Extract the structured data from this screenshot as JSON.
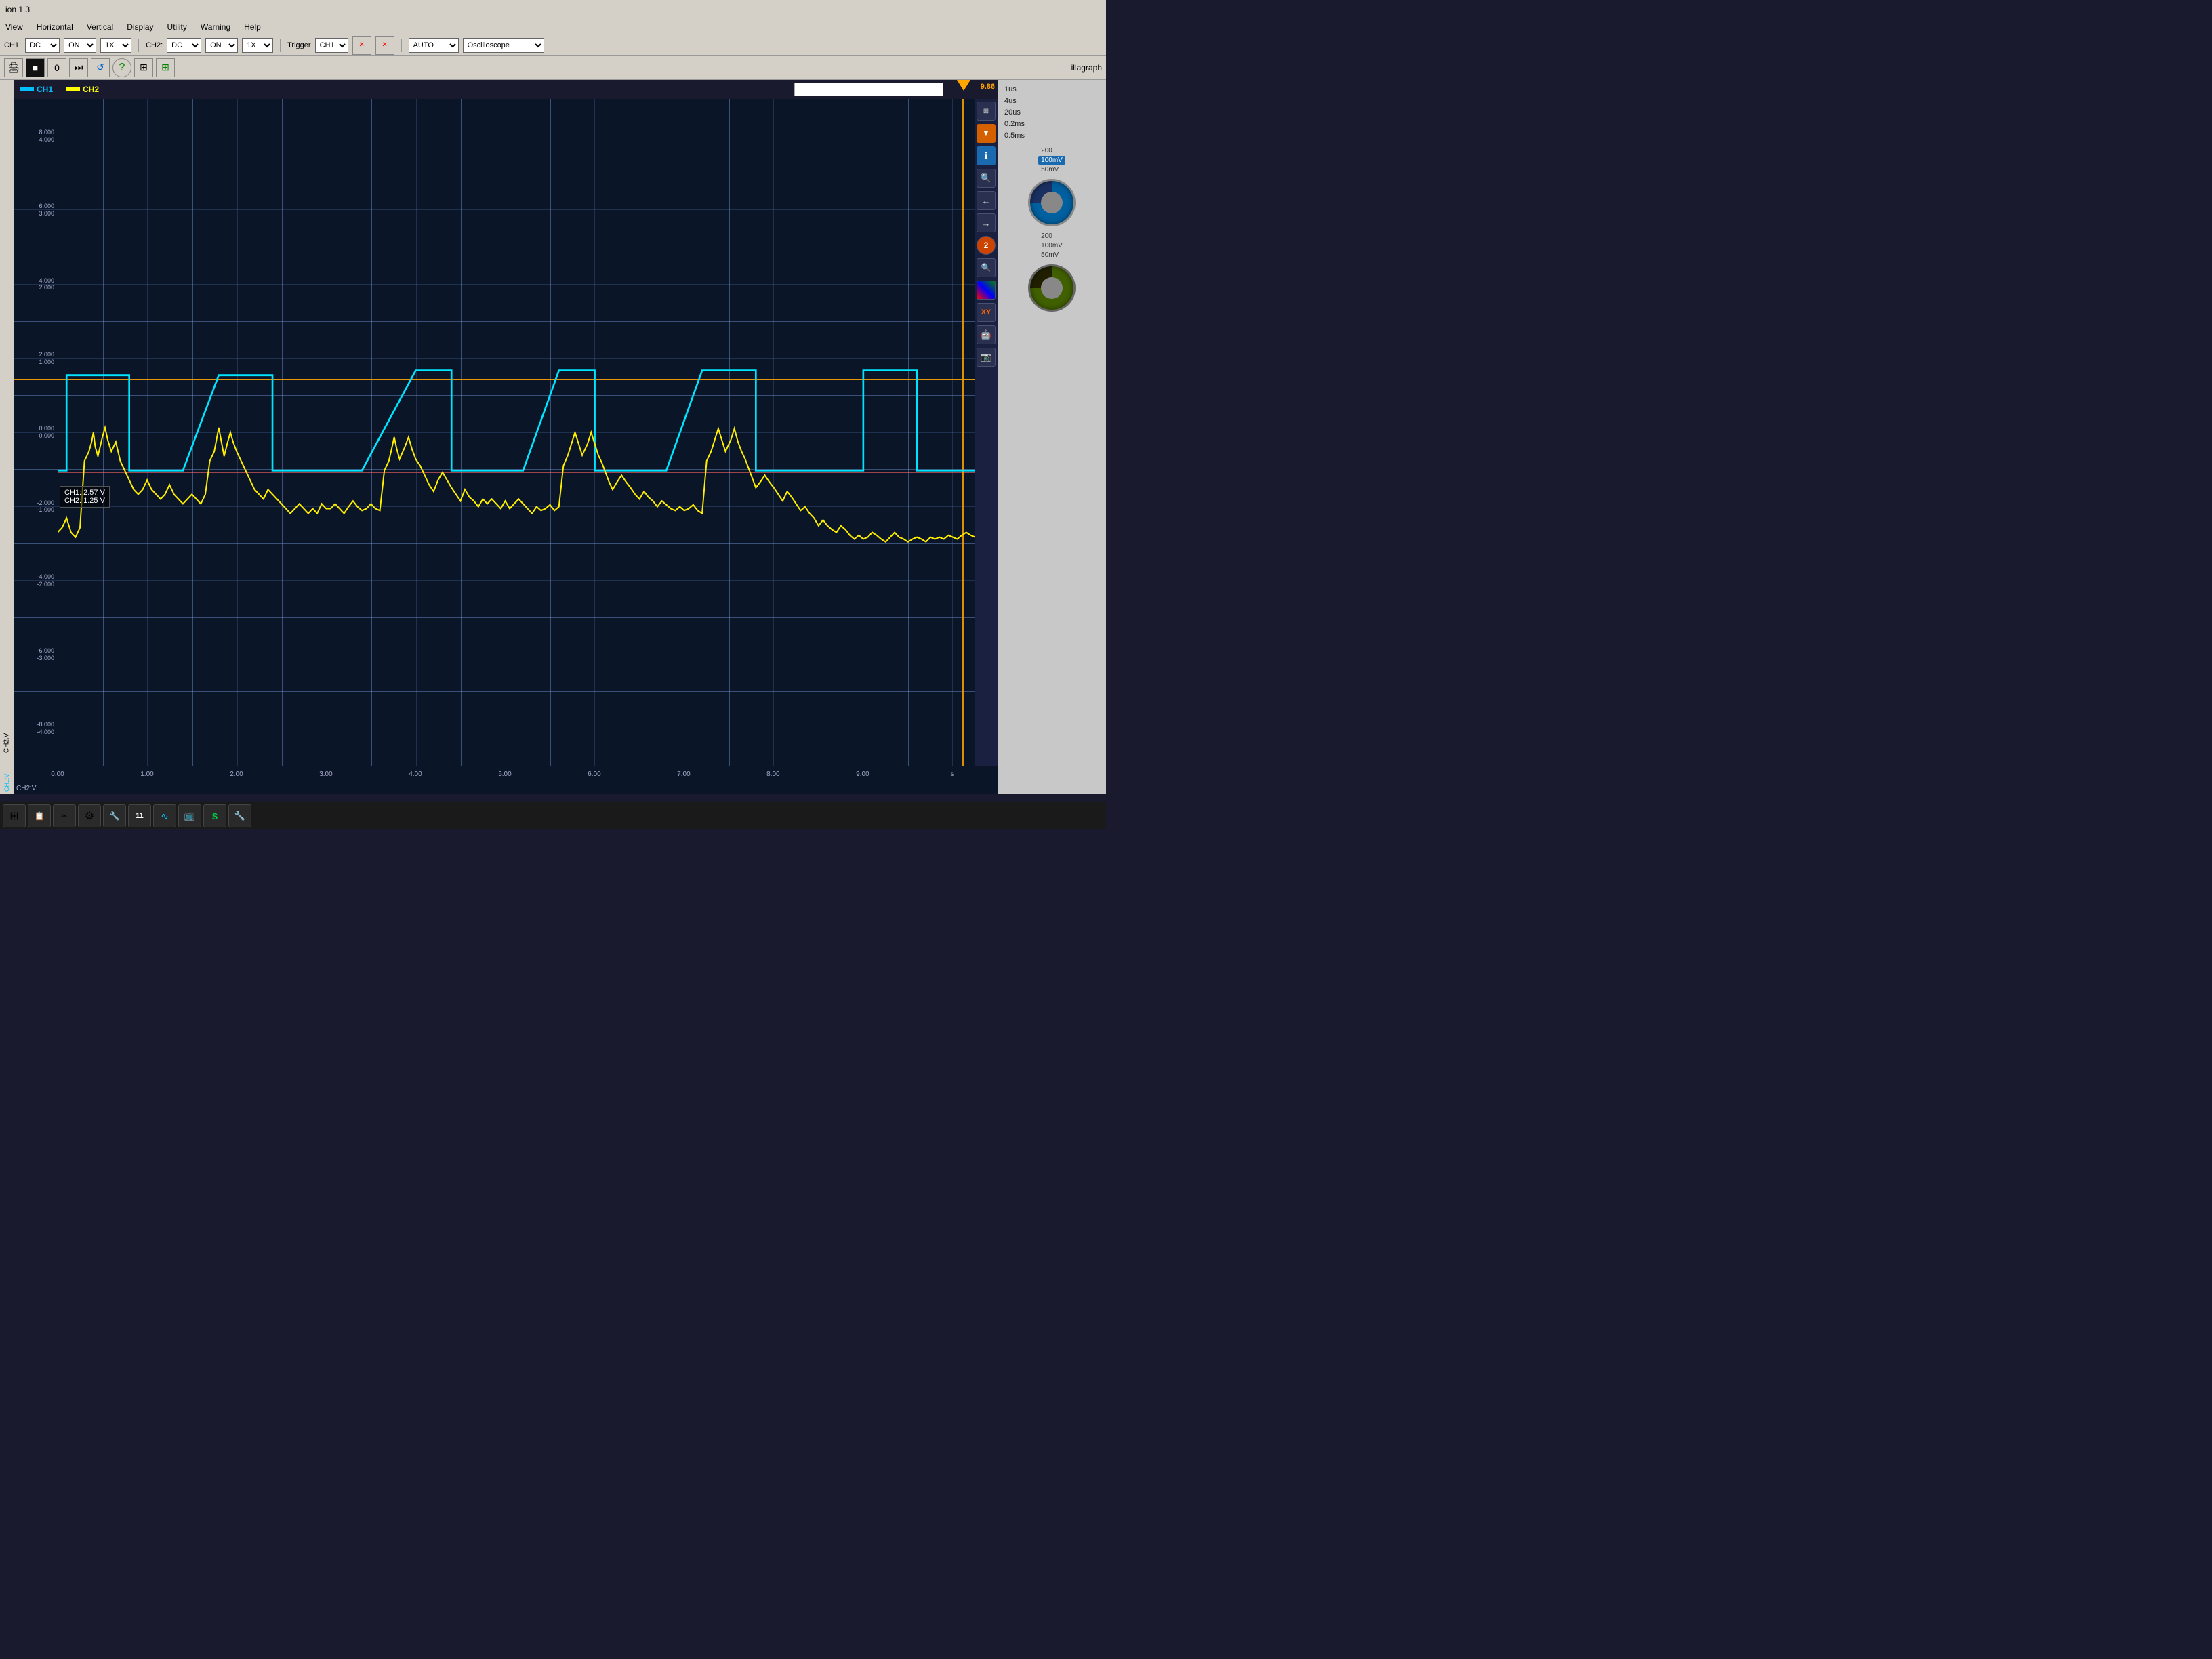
{
  "app": {
    "title": "ion 1.3",
    "window_label": "illagraph"
  },
  "menu": {
    "items": [
      "View",
      "Horizontal",
      "Vertical",
      "Display",
      "Utility",
      "Warning",
      "Help"
    ]
  },
  "toolbar1": {
    "ch1_label": "CH1:",
    "ch1_coupling": "DC",
    "ch1_on": "ON",
    "ch1_probe": "1X",
    "ch2_label": "CH2:",
    "ch2_coupling": "DC",
    "ch2_on": "ON",
    "ch2_probe": "1X",
    "trigger_label": "Trigger",
    "trigger_ch": "CH1",
    "trigger_mode": "AUTO",
    "scope_mode": "Oscilloscope"
  },
  "scope": {
    "ch1_label": "CH1",
    "ch2_label": "CH2",
    "ch1_color": "#00bfff",
    "ch2_color": "#ffff00",
    "trigger_value": "9.86",
    "meas_ch1": "CH1: 2.57 V",
    "meas_ch2": "CH2: 1.25 V",
    "ch1_v_label": "CH1:V",
    "ch2_v_label": "CH2:V",
    "y_labels": [
      "8.000\n4.000",
      "6.000\n3.000",
      "4.000\n2.000",
      "2.000\n1.000",
      "0.000\n0.000",
      "-2.000\n-1.000",
      "-4.000\n-2.000",
      "-6.000\n-3.000",
      "-8.000\n-4.000"
    ],
    "x_labels": [
      "0.00",
      "1.00",
      "2.00",
      "3.00",
      "4.00",
      "5.00",
      "6.00",
      "7.00",
      "8.00",
      "9.00",
      "s"
    ],
    "x_unit": "s"
  },
  "right_panel": {
    "time_options": [
      {
        "label": "1us",
        "selected": false
      },
      {
        "label": "4us",
        "selected": false
      },
      {
        "label": "20us",
        "selected": false
      },
      {
        "label": "0.2ms",
        "selected": false
      },
      {
        "label": "0.5ms",
        "selected": false
      },
      {
        "label": "200",
        "selected": false
      },
      {
        "label": "100mV",
        "selected": true,
        "ch": "blue"
      },
      {
        "label": "50mV",
        "selected": false
      },
      {
        "label": "200",
        "selected": false
      },
      {
        "label": "100mV",
        "selected": false
      },
      {
        "label": "50mV",
        "selected": false
      }
    ],
    "knob1_ch": "CH1",
    "knob2_ch": "CH2"
  },
  "taskbar": {
    "items": [
      "⊞",
      "📋",
      "✂",
      "⚙",
      "🔧",
      "11",
      "∿",
      "📺",
      "S",
      "🔧"
    ]
  }
}
